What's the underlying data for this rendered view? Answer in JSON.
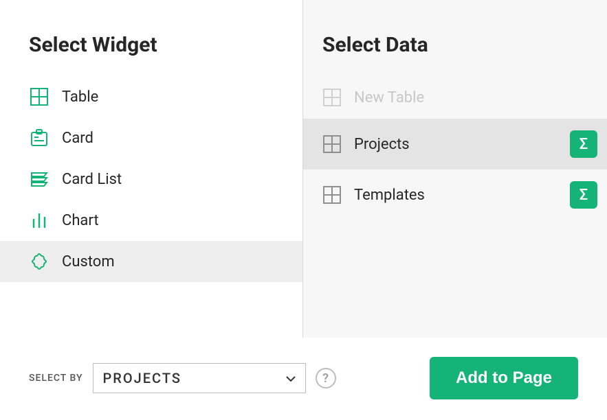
{
  "left": {
    "title": "Select Widget",
    "items": [
      {
        "icon": "table",
        "label": "Table",
        "selected": false
      },
      {
        "icon": "card",
        "label": "Card",
        "selected": false
      },
      {
        "icon": "cardlist",
        "label": "Card List",
        "selected": false
      },
      {
        "icon": "chart",
        "label": "Chart",
        "selected": false
      },
      {
        "icon": "custom",
        "label": "Custom",
        "selected": true
      }
    ]
  },
  "right": {
    "title": "Select Data",
    "items": [
      {
        "icon": "table",
        "label": "New Table",
        "disabled": true,
        "selected": false,
        "summary": false
      },
      {
        "icon": "table",
        "label": "Projects",
        "disabled": false,
        "selected": true,
        "summary": true
      },
      {
        "icon": "table",
        "label": "Templates",
        "disabled": false,
        "selected": false,
        "summary": true
      }
    ]
  },
  "footer": {
    "select_by_label": "SELECT BY",
    "select_by_value": "PROJECTS",
    "help_glyph": "?",
    "add_label": "Add to Page"
  },
  "glyphs": {
    "sigma": "Σ"
  }
}
